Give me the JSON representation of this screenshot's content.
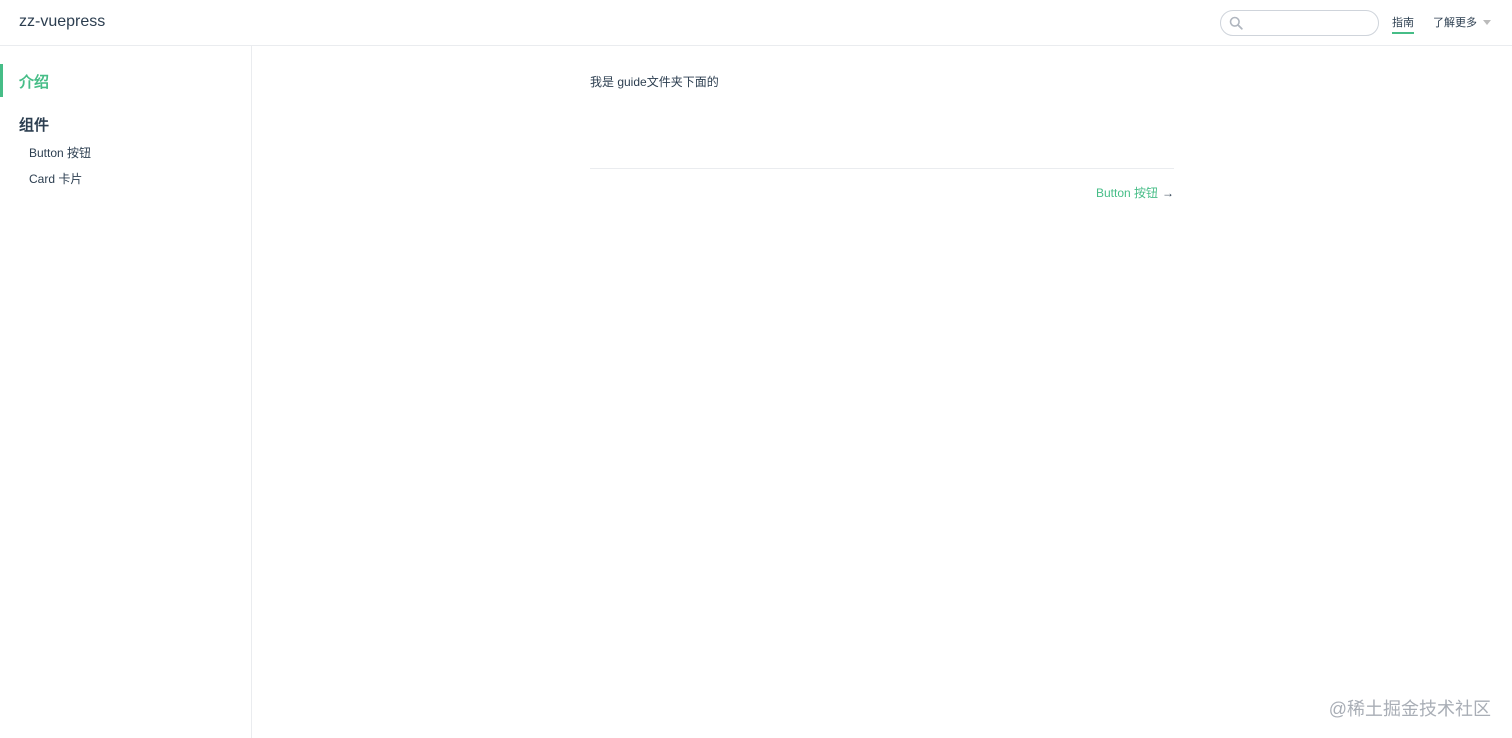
{
  "navbar": {
    "site_name": "zz-vuepress",
    "search": {
      "value": "",
      "placeholder": ""
    },
    "links": [
      {
        "label": "指南"
      },
      {
        "label": "了解更多"
      }
    ]
  },
  "sidebar": {
    "active_item": "介绍",
    "group_title": "组件",
    "sub_items": [
      {
        "label": "Button 按钮"
      },
      {
        "label": "Card 卡片"
      }
    ]
  },
  "content": {
    "body_text": "我是 guide文件夹下面的"
  },
  "page_nav": {
    "next_label": "Button 按钮",
    "next_arrow": "→"
  },
  "watermark": "@稀土掘金技术社区",
  "colors": {
    "accent": "#46bd87",
    "text": "#2c3e50",
    "border": "#eaecef"
  },
  "icons": {
    "search": "search-icon",
    "dropdown": "caret-down-icon"
  }
}
